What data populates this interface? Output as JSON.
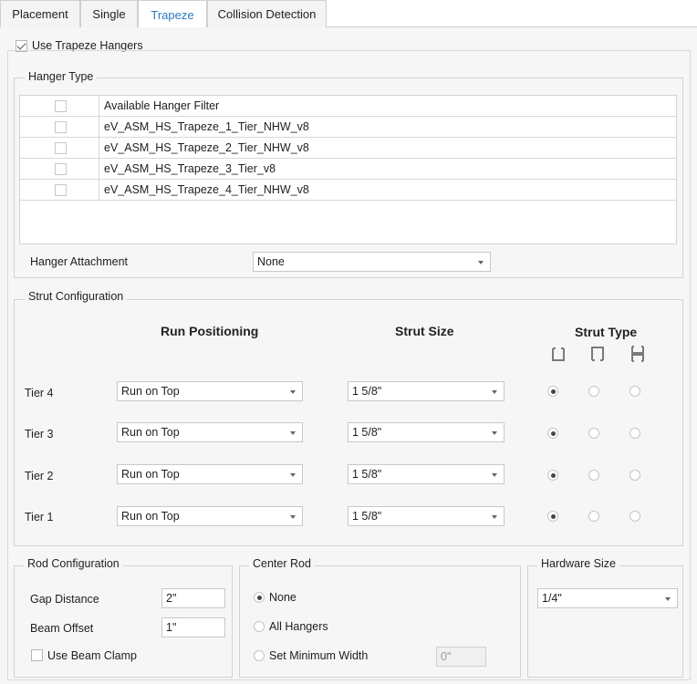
{
  "tabs": [
    {
      "label": "Placement"
    },
    {
      "label": "Single"
    },
    {
      "label": "Trapeze"
    },
    {
      "label": "Collision Detection"
    }
  ],
  "use_trapeze_hangers": {
    "label": "Use Trapeze Hangers",
    "checked": true
  },
  "hanger_type": {
    "title": "Hanger Type",
    "header": "Available Hanger Filter",
    "items": [
      {
        "name": "eV_ASM_HS_Trapeze_1_Tier_NHW_v8",
        "checked": false
      },
      {
        "name": "eV_ASM_HS_Trapeze_2_Tier_NHW_v8",
        "checked": false
      },
      {
        "name": "eV_ASM_HS_Trapeze_3_Tier_v8",
        "checked": false
      },
      {
        "name": "eV_ASM_HS_Trapeze_4_Tier_NHW_v8",
        "checked": false
      }
    ],
    "attachment_label": "Hanger Attachment",
    "attachment_value": "None"
  },
  "strut_config": {
    "title": "Strut Configuration",
    "col_run": "Run Positioning",
    "col_size": "Strut Size",
    "col_type": "Strut Type",
    "type_icons": [
      "strut-channel-open-down-icon",
      "strut-channel-open-up-icon",
      "strut-channel-back-to-back-icon"
    ],
    "tiers": [
      {
        "label": "Tier 4",
        "run": "Run on Top",
        "size": "1 5/8\"",
        "type_index": 0
      },
      {
        "label": "Tier 3",
        "run": "Run on Top",
        "size": "1 5/8\"",
        "type_index": 0
      },
      {
        "label": "Tier 2",
        "run": "Run on Top",
        "size": "1 5/8\"",
        "type_index": 0
      },
      {
        "label": "Tier 1",
        "run": "Run on Top",
        "size": "1 5/8\"",
        "type_index": 0
      }
    ]
  },
  "rod_config": {
    "title": "Rod Configuration",
    "gap_label": "Gap Distance",
    "gap_value": "2\"",
    "beam_label": "Beam Offset",
    "beam_value": "1\"",
    "clamp_label": "Use Beam Clamp",
    "clamp_checked": false
  },
  "center_rod": {
    "title": "Center Rod",
    "options": [
      {
        "label": "None",
        "selected": true
      },
      {
        "label": "All Hangers",
        "selected": false
      },
      {
        "label": "Set Minimum Width",
        "selected": false
      }
    ],
    "min_width_value": "0\""
  },
  "hardware_size": {
    "title": "Hardware Size",
    "value": "1/4\""
  },
  "colors": {
    "accent": "#2a7bc0",
    "panel": "#f6f6f6",
    "border": "#d2d2d2"
  }
}
